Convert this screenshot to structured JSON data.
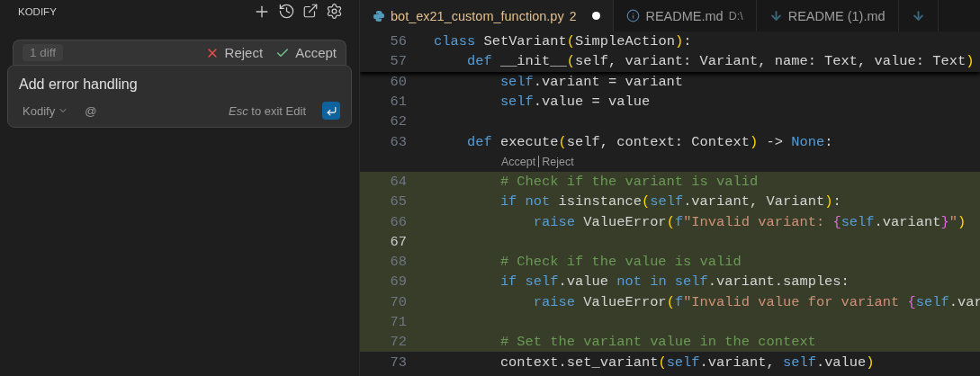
{
  "sidebar": {
    "title": "KODIFY",
    "diff_bar": {
      "count": "1 diff",
      "reject": "Reject",
      "accept": "Accept"
    },
    "edit_box": {
      "value": "Add error handling",
      "model": "Kodify",
      "mention": "@",
      "hint": "*Esc* to exit Edit"
    }
  },
  "tabs": [
    {
      "kind": "python",
      "label": "bot_ex21_custom_function.py",
      "badge": "2",
      "modified": true,
      "selected": true
    },
    {
      "kind": "info",
      "label": "README.md",
      "description": "D:\\",
      "modified": false,
      "selected": false
    },
    {
      "kind": "download",
      "label": "README (1).md",
      "modified": false,
      "selected": false
    },
    {
      "kind": "download",
      "modified": false,
      "selected": false
    }
  ],
  "editor": {
    "sticky_lines": [
      {
        "number": "56",
        "tokens": [
          {
            "t": "class",
            "kind": "kw"
          },
          {
            "t": " SetVariant",
            "kind": "p"
          },
          {
            "t": "(",
            "kind": "br"
          },
          {
            "t": "SimpleAction",
            "kind": "p"
          },
          {
            "t": ")",
            "kind": "br"
          },
          {
            "t": ":",
            "kind": "p"
          }
        ]
      },
      {
        "number": "57",
        "tokens": [
          {
            "t": "    def",
            "kind": "kw"
          },
          {
            "t": " __init__",
            "kind": "p"
          },
          {
            "t": "(",
            "kind": "br"
          },
          {
            "t": "self, variant: Variant, name: Text, value: Text",
            "kind": "p"
          },
          {
            "t": ")",
            "kind": "br"
          }
        ]
      }
    ],
    "lines": [
      {
        "kind": "code",
        "number": "60",
        "added": false,
        "tokens": [
          {
            "t": "        self",
            "kind": "kw"
          },
          {
            "t": ".variant = variant",
            "kind": "p"
          }
        ]
      },
      {
        "kind": "code",
        "number": "61",
        "added": false,
        "tokens": [
          {
            "t": "        self",
            "kind": "kw"
          },
          {
            "t": ".value = value",
            "kind": "p"
          }
        ]
      },
      {
        "kind": "code",
        "number": "62",
        "added": false
      },
      {
        "kind": "code",
        "number": "63",
        "added": false,
        "tokens": [
          {
            "t": "    def",
            "kind": "kw"
          },
          {
            "t": " execute",
            "kind": "p"
          },
          {
            "t": "(",
            "kind": "br"
          },
          {
            "t": "self, context: Context",
            "kind": "p"
          },
          {
            "t": ")",
            "kind": "br"
          },
          {
            "t": " -> ",
            "kind": "p"
          },
          {
            "t": "None",
            "kind": "kw"
          },
          {
            "t": ":",
            "kind": "p"
          }
        ]
      },
      {
        "kind": "lens",
        "accept": "Accept",
        "reject": "Reject"
      },
      {
        "kind": "code",
        "number": "64",
        "added": true,
        "tokens": [
          {
            "t": "        # Check if the variant is valid",
            "kind": "com"
          }
        ]
      },
      {
        "kind": "code",
        "number": "65",
        "added": true,
        "tokens": [
          {
            "t": "        if not",
            "kind": "kw"
          },
          {
            "t": " isinstance",
            "kind": "p"
          },
          {
            "t": "(",
            "kind": "br"
          },
          {
            "t": "self",
            "kind": "kw"
          },
          {
            "t": ".variant, Variant",
            "kind": "p"
          },
          {
            "t": ")",
            "kind": "br"
          },
          {
            "t": ":",
            "kind": "p"
          }
        ]
      },
      {
        "kind": "code",
        "number": "66",
        "added": true,
        "tokens": [
          {
            "t": "            raise",
            "kind": "kw"
          },
          {
            "t": " ValueError",
            "kind": "p"
          },
          {
            "t": "(",
            "kind": "br"
          },
          {
            "t": "f",
            "kind": "kw"
          },
          {
            "t": "\"Invalid variant: ",
            "kind": "str"
          },
          {
            "t": "{",
            "kind": "cb"
          },
          {
            "t": "self",
            "kind": "kw"
          },
          {
            "t": ".variant",
            "kind": "p"
          },
          {
            "t": "}",
            "kind": "cb"
          },
          {
            "t": "\"",
            "kind": "str"
          },
          {
            "t": ")",
            "kind": "br"
          }
        ]
      },
      {
        "kind": "code",
        "number": "67",
        "added": true,
        "current": true
      },
      {
        "kind": "code",
        "number": "68",
        "added": true,
        "tokens": [
          {
            "t": "        # Check if the value is valid",
            "kind": "com"
          }
        ]
      },
      {
        "kind": "code",
        "number": "69",
        "added": true,
        "tokens": [
          {
            "t": "        if",
            "kind": "kw"
          },
          {
            "t": " self",
            "kind": "kw"
          },
          {
            "t": ".value ",
            "kind": "p"
          },
          {
            "t": "not in",
            "kind": "kw"
          },
          {
            "t": " self",
            "kind": "kw"
          },
          {
            "t": ".variant.samples:",
            "kind": "p"
          }
        ]
      },
      {
        "kind": "code",
        "number": "70",
        "added": true,
        "tokens": [
          {
            "t": "            raise",
            "kind": "kw"
          },
          {
            "t": " ValueError",
            "kind": "p"
          },
          {
            "t": "(",
            "kind": "br"
          },
          {
            "t": "f",
            "kind": "kw"
          },
          {
            "t": "\"Invalid value for variant ",
            "kind": "str"
          },
          {
            "t": "{",
            "kind": "cb"
          },
          {
            "t": "self",
            "kind": "kw"
          },
          {
            "t": ".var",
            "kind": "p"
          }
        ]
      },
      {
        "kind": "code",
        "number": "71",
        "added": true
      },
      {
        "kind": "code",
        "number": "72",
        "added": true,
        "tokens": [
          {
            "t": "        # Set the variant value in the context",
            "kind": "com"
          }
        ]
      },
      {
        "kind": "code",
        "number": "73",
        "added": false,
        "tokens": [
          {
            "t": "        context.set_variant",
            "kind": "p"
          },
          {
            "t": "(",
            "kind": "br"
          },
          {
            "t": "self",
            "kind": "kw"
          },
          {
            "t": ".variant, ",
            "kind": "p"
          },
          {
            "t": "self",
            "kind": "kw"
          },
          {
            "t": ".value",
            "kind": "p"
          },
          {
            "t": ")",
            "kind": "br"
          }
        ]
      }
    ]
  }
}
